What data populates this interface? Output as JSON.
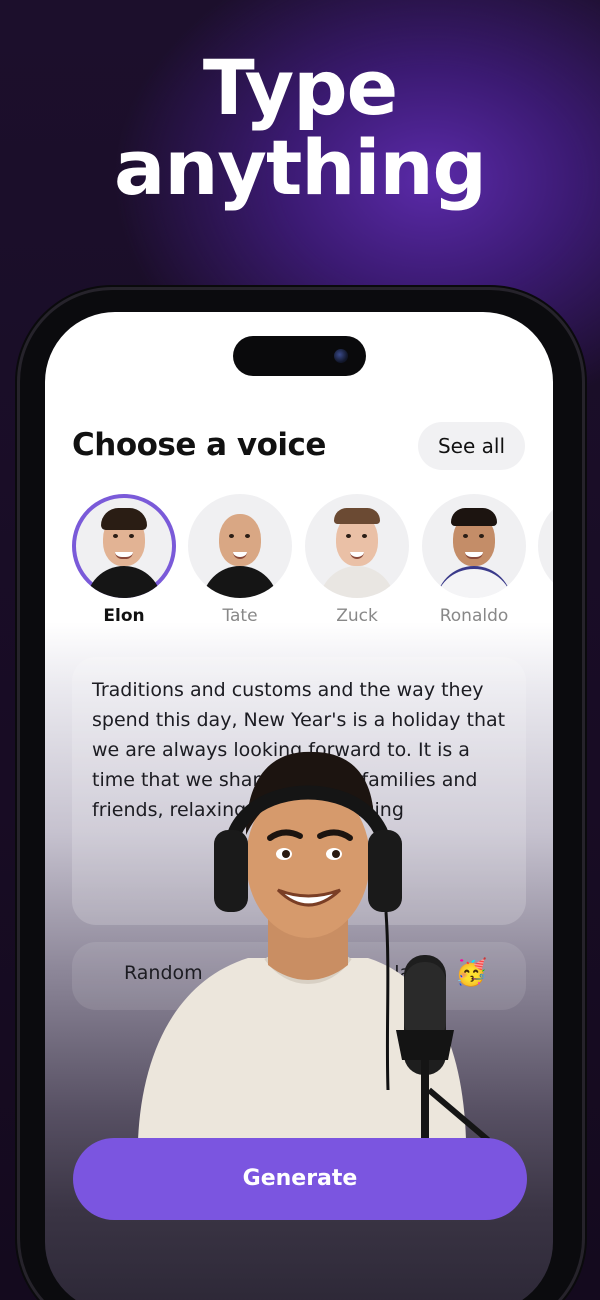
{
  "promo": {
    "headline_line1": "Type",
    "headline_line2": "anything"
  },
  "screen": {
    "title": "Choose a voice",
    "see_all_label": "See all",
    "voices": [
      {
        "name": "Elon",
        "selected": true
      },
      {
        "name": "Tate",
        "selected": false
      },
      {
        "name": "Zuck",
        "selected": false
      },
      {
        "name": "Ronaldo",
        "selected": false
      }
    ],
    "text_input_value": "Traditions and customs and the way they spend this day, New Year's is a holiday that we are always looking forward to. It is a time that we share with our families and friends, relaxing and exchanging",
    "random_label": "Random",
    "random_suffix": "emplates",
    "random_emoji": "🥳",
    "generate_label": "Generate"
  },
  "colors": {
    "accent": "#7b55e0",
    "selected_ring": "#7a5ad9",
    "background_top": "#1c0f2c"
  }
}
